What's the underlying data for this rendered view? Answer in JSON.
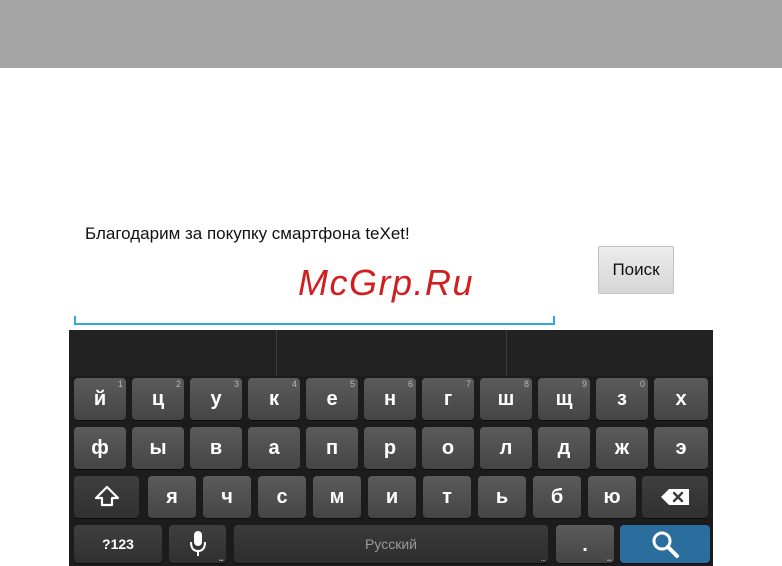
{
  "screen": {
    "message": "Благодарим за покупку смартфона teXet!",
    "watermark": "McGrp.Ru",
    "search_button": "Поиск"
  },
  "keyboard": {
    "row1": [
      {
        "key": "й",
        "hint": "1"
      },
      {
        "key": "ц",
        "hint": "2"
      },
      {
        "key": "у",
        "hint": "3"
      },
      {
        "key": "к",
        "hint": "4"
      },
      {
        "key": "е",
        "hint": "5"
      },
      {
        "key": "н",
        "hint": "6"
      },
      {
        "key": "г",
        "hint": "7"
      },
      {
        "key": "ш",
        "hint": "8"
      },
      {
        "key": "щ",
        "hint": "9"
      },
      {
        "key": "з",
        "hint": "0"
      },
      {
        "key": "х",
        "hint": ""
      }
    ],
    "row2": [
      "ф",
      "ы",
      "в",
      "а",
      "п",
      "р",
      "о",
      "л",
      "д",
      "ж",
      "э"
    ],
    "row3": [
      "я",
      "ч",
      "с",
      "м",
      "и",
      "т",
      "ь",
      "б",
      "ю"
    ],
    "bottom": {
      "symbols": "?123",
      "space": "Русский",
      "period": ".",
      "dots": "..."
    },
    "icons": {
      "shift": "shift-icon",
      "backspace": "backspace-icon",
      "mic": "microphone-icon",
      "search": "search-icon"
    },
    "colors": {
      "key": "#4f4f4f",
      "keyboard_bg": "#1c1c1c",
      "go_key": "#2a6e9e",
      "field_underline": "#33a6dc",
      "watermark": "#d21e1e"
    }
  }
}
